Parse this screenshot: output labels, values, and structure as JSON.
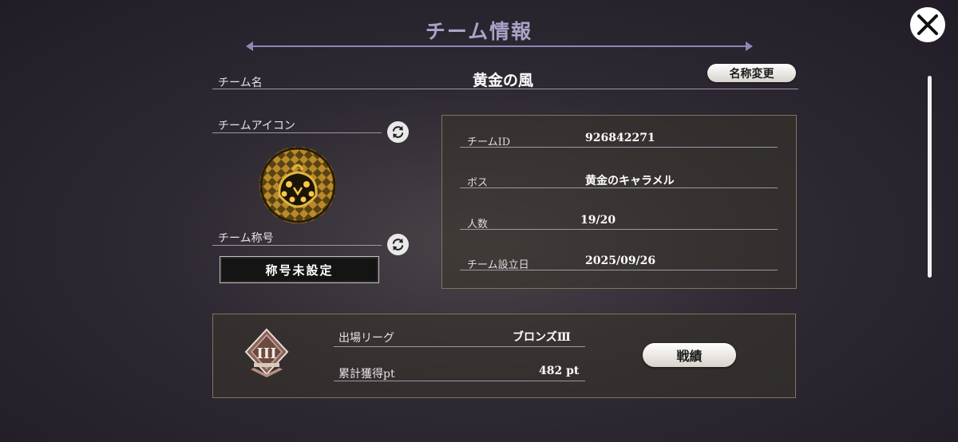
{
  "header": {
    "title": "チーム情報"
  },
  "team": {
    "name_label": "チーム名",
    "name": "黄金の風",
    "rename_button": "名称変更",
    "icon_label": "チームアイコン",
    "title_label": "チーム称号",
    "title_value": "称号未設定"
  },
  "info": {
    "rows": [
      {
        "key": "チームID",
        "value": "926842271"
      },
      {
        "key": "ボス",
        "value": "黄金のキャラメル"
      },
      {
        "key": "人数",
        "value": "19/20"
      },
      {
        "key": "チーム設立日",
        "value": "2025/09/26"
      }
    ]
  },
  "league": {
    "league_label": "出場リーグ",
    "league_value": "ブロンズⅢ",
    "points_label": "累計獲得pt",
    "points_value": "482 pt",
    "badge_text": "III",
    "record_button": "戦績"
  },
  "icons": {
    "close": "close-icon",
    "refresh": "refresh-icon",
    "emblem": "ladybug-emblem-icon",
    "league": "bronze-league-badge-icon"
  },
  "colors": {
    "accent": "#a9a3c8",
    "panel_border": "#7d775f",
    "gold": "#c89a2a"
  }
}
